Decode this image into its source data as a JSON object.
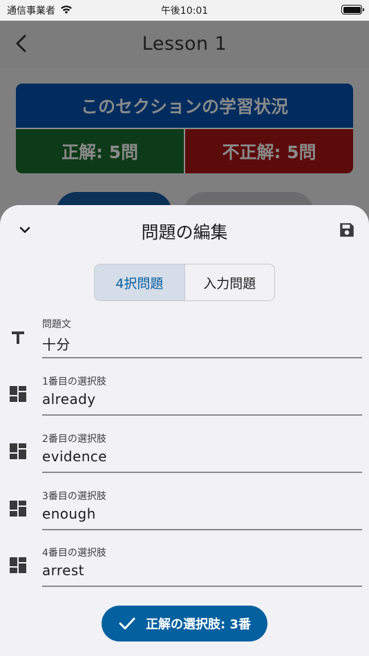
{
  "status_bar": {
    "carrier": "通信事業者",
    "time": "午後10:01"
  },
  "nav": {
    "title": "Lesson 1",
    "back_icon": "chevron-left-icon"
  },
  "progress_card": {
    "heading": "このセクションの学習状況",
    "correct": "正解: 5問",
    "incorrect": "不正解: 5問",
    "colors": {
      "heading": "#022c5f",
      "correct": "#0d3a18",
      "incorrect": "#5a0b0a"
    }
  },
  "sheet": {
    "title": "問題の編集",
    "collapse_icon": "chevron-down-icon",
    "save_icon": "save-icon",
    "segments": [
      "4択問題",
      "入力問題"
    ],
    "selected_segment": "4択問題",
    "fields": [
      {
        "label": "問題文",
        "value": "十分",
        "icon": "text-icon"
      },
      {
        "label": "1番目の選択肢",
        "value": "already",
        "icon": "dashboard-icon"
      },
      {
        "label": "2番目の選択肢",
        "value": "evidence",
        "icon": "dashboard-icon"
      },
      {
        "label": "3番目の選択肢",
        "value": "enough",
        "icon": "dashboard-icon"
      },
      {
        "label": "4番目の選択肢",
        "value": "arrest",
        "icon": "dashboard-icon"
      }
    ],
    "answer_button": "正解の選択肢: 3番",
    "accent": "#05609f"
  }
}
